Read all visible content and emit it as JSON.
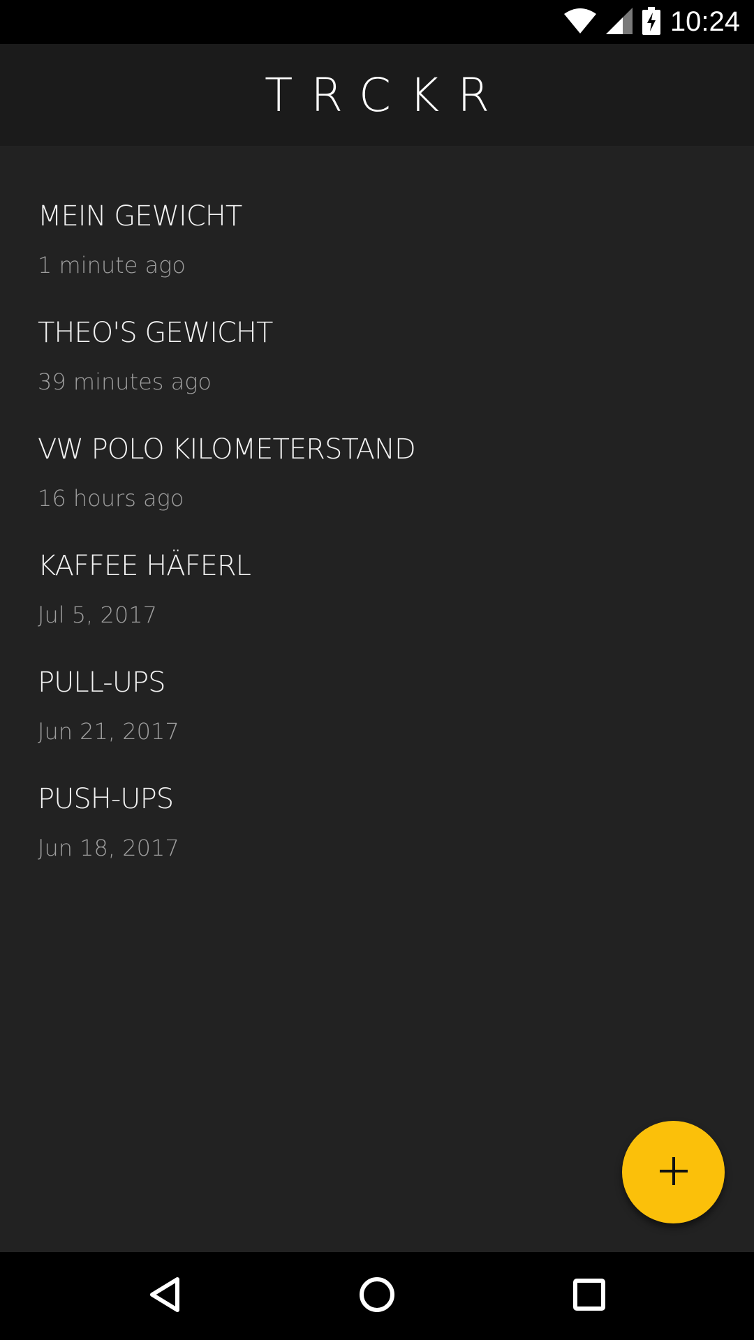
{
  "status_bar": {
    "time": "10:24",
    "icons": [
      "wifi-icon",
      "cell-signal-icon",
      "battery-charging-icon"
    ]
  },
  "app_bar": {
    "title": "TRCKR"
  },
  "trackers": [
    {
      "name": "MEIN GEWICHT",
      "updated": "1 minute ago"
    },
    {
      "name": "THEO'S GEWICHT",
      "updated": "39 minutes ago"
    },
    {
      "name": "VW POLO KILOMETERSTAND",
      "updated": "16 hours ago"
    },
    {
      "name": "KAFFEE HÄFERL",
      "updated": "Jul 5, 2017"
    },
    {
      "name": "PULL-UPS",
      "updated": "Jun 21, 2017"
    },
    {
      "name": "PUSH-UPS",
      "updated": "Jun 18, 2017"
    }
  ],
  "fab": {
    "icon": "plus-icon",
    "color": "#FBC00A"
  },
  "nav_bar": {
    "icons": [
      "back-icon",
      "home-icon",
      "recents-icon"
    ]
  },
  "colors": {
    "background": "#222222",
    "app_bar": "#1B1B1B",
    "accent": "#FBC00A"
  }
}
